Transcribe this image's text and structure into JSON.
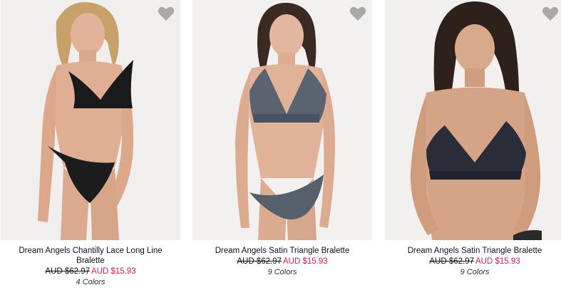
{
  "products": [
    {
      "name": "Dream Angels Chantilly Lace Long Line Bralette",
      "old_price": "AUD $62.97",
      "new_price": "AUD $15.93",
      "colors": "4 Colors",
      "heart_icon": "heart-icon"
    },
    {
      "name": "Dream Angels Satin Triangle Bralette",
      "old_price": "AUD $62.97",
      "new_price": "AUD $15.93",
      "colors": "9 Colors",
      "heart_icon": "heart-icon"
    },
    {
      "name": "Dream Angels Satin Triangle Bralette",
      "old_price": "AUD $62.97",
      "new_price": "AUD $15.93",
      "colors": "9 Colors",
      "heart_icon": "heart-icon"
    }
  ],
  "colors": {
    "sale_price": "#e0185f",
    "heart": "#a9a9a9",
    "text": "#111111"
  }
}
